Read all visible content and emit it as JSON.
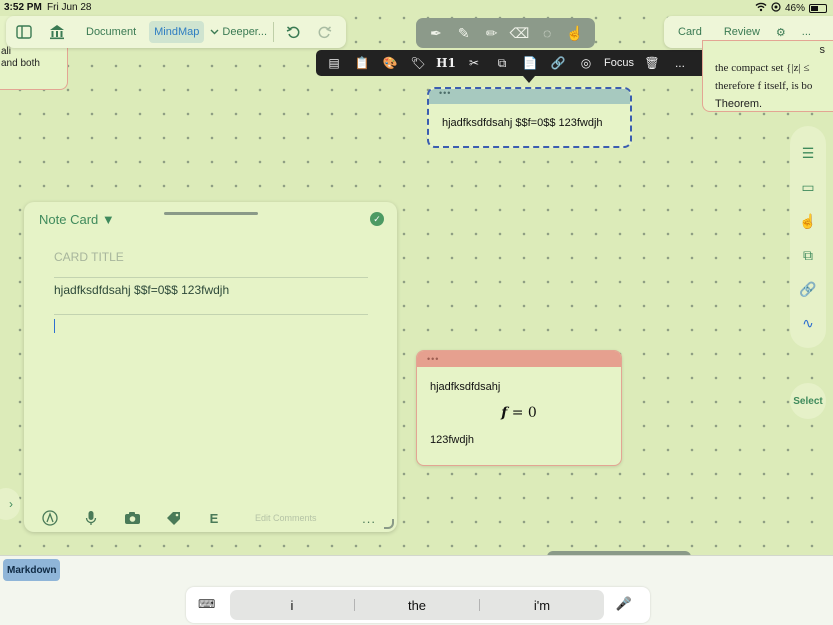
{
  "status_bar": {
    "time": "3:52 PM",
    "date": "Fri Jun 28",
    "battery": "46%"
  },
  "toolbar_left": {
    "document": "Document",
    "mindmap": "MindMap",
    "deeper": "Deeper..."
  },
  "left_card": {
    "line1": "ali",
    "line2": "and both"
  },
  "context_menu": {
    "h1": "H1",
    "focus": "Focus",
    "more": "..."
  },
  "toolbar_right": {
    "card": "Card",
    "review": "Review",
    "more": "..."
  },
  "right_card": {
    "line0": "s",
    "line1": "the compact set {|z| ≤",
    "line2": "therefore f itself, is bo",
    "line3": "Theorem."
  },
  "selected_card": {
    "text": "hjadfksdfdsahj $$f=0$$ 123fwdjh"
  },
  "note_card": {
    "title": "Note Card ▼",
    "card_title_placeholder": "CARD TITLE",
    "content": "hjadfksdfdsahj $$f=0$$ 123fwdjh",
    "edit_comments": "Edit Comments",
    "more": "..."
  },
  "formula_card": {
    "line1": "hjadfksdfdsahj",
    "math_var": "f",
    "math_rest": "= 0",
    "line3": "123fwdjh"
  },
  "side_bar": {
    "select": "Select"
  },
  "keyboard": {
    "markdown": "Markdown",
    "suggestions": [
      "i",
      "the",
      "i'm"
    ]
  },
  "colors": {
    "canvas": "#dcebb9",
    "accent_green": "#3f8a5c",
    "selection_blue": "#3b5db0",
    "card_header_teal": "#a7c9bf",
    "card_header_salmon": "#e6a08f"
  }
}
